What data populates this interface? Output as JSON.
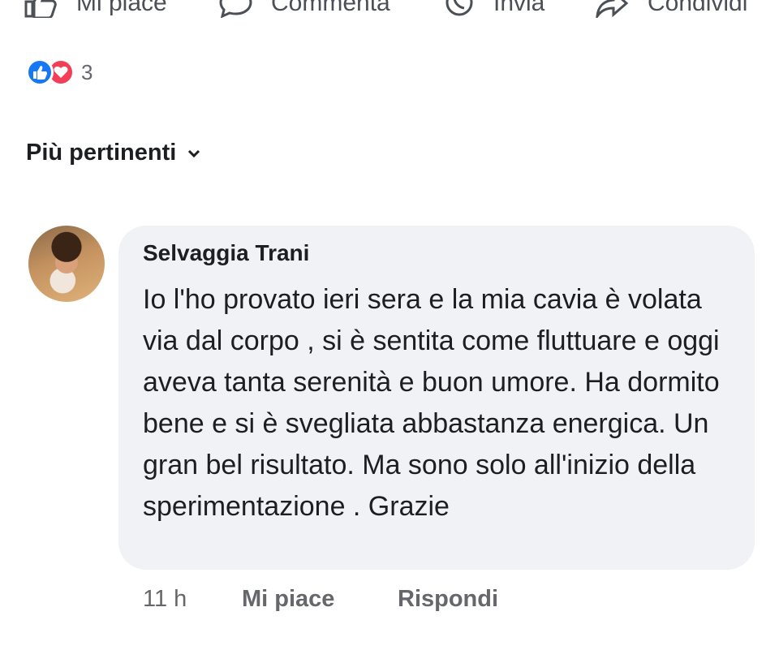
{
  "actions": {
    "like": {
      "label": "Mi piace",
      "icon": "thumbs-up-icon"
    },
    "comment": {
      "label": "Commenta",
      "icon": "comment-icon"
    },
    "send": {
      "label": "Invia",
      "icon": "whatsapp-icon"
    },
    "share": {
      "label": "Condividi",
      "icon": "share-icon"
    }
  },
  "reactions": {
    "count": "3",
    "types": [
      "like",
      "love"
    ]
  },
  "sort": {
    "label": "Più pertinenti",
    "icon": "chevron-down-icon"
  },
  "comment": {
    "author": "Selvaggia Trani",
    "text": "Io l'ho provato ieri sera e la mia cavia è volata via dal corpo , si è sentita come fluttuare e oggi aveva tanta serenità e buon umore. Ha dormito bene e si è svegliata abbastanza energica. Un gran bel risultato. Ma sono solo all'inizio della sperimentazione . Grazie",
    "time": "11 h",
    "like_label": "Mi piace",
    "reply_label": "Rispondi"
  },
  "colors": {
    "like_blue": "#1877f2",
    "love_red": "#f33e58",
    "bubble_bg": "#f0f2f5",
    "meta_gray": "#65676b"
  }
}
